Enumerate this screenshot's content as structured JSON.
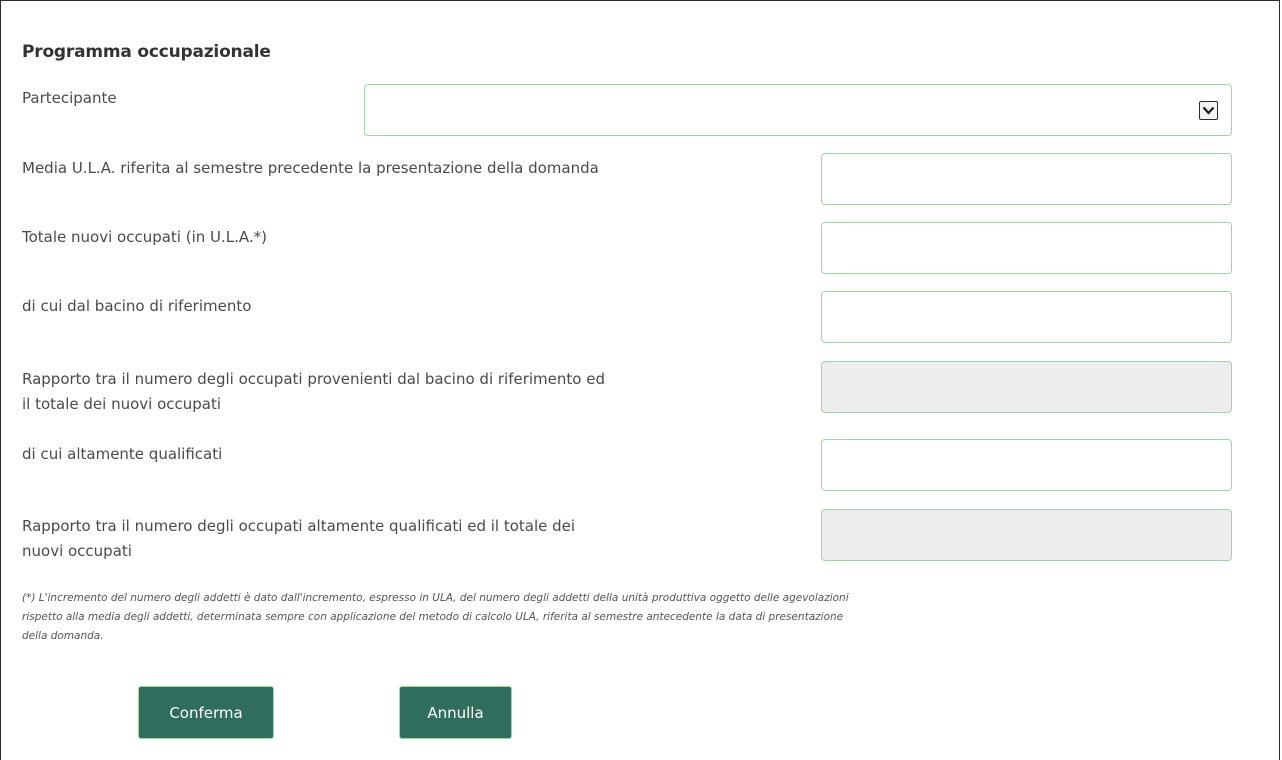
{
  "form": {
    "title": "Programma occupazionale",
    "fields": {
      "partecipante": {
        "label": "Partecipante",
        "value": ""
      },
      "media_ula": {
        "label": "Media U.L.A. riferita al semestre precedente la presentazione della domanda",
        "value": ""
      },
      "totale_nuovi_occupati": {
        "label": "Totale nuovi occupati (in U.L.A.*)",
        "value": ""
      },
      "bacino_riferimento": {
        "label": "di cui dal bacino di riferimento",
        "value": ""
      },
      "rapporto_bacino": {
        "label_line1": "Rapporto tra il numero degli occupati provenienti dal bacino di riferimento ed",
        "label_line2": "il totale dei nuovi occupati",
        "value": ""
      },
      "altamente_qualificati": {
        "label": "di cui altamente qualificati",
        "value": ""
      },
      "rapporto_qualificati": {
        "label_line1": "Rapporto tra il numero degli occupati altamente qualificati ed il totale dei",
        "label_line2": "nuovi occupati",
        "value": ""
      }
    },
    "footnote": {
      "line1": "(*) L'incremento del numero degli addetti è dato dall'incremento, espresso in ULA, del numero degli addetti della unità produttiva oggetto delle agevolazioni",
      "line2": "rispetto alla media degli addetti, determinata sempre con applicazione del metodo di calcolo ULA, riferita al semestre antecedente la data di presentazione",
      "line3": "della domanda."
    },
    "buttons": {
      "confirm_label": "Conferma",
      "cancel_label": "Annulla"
    }
  },
  "icons": {
    "select_toggle": "chevron-down-icon"
  },
  "colors": {
    "button_bg": "#2f6e5d",
    "field_border": "#9ed6a4",
    "readonly_bg": "#ededed"
  }
}
